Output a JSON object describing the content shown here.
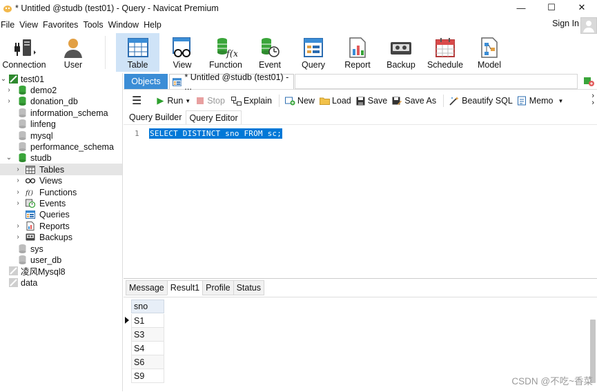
{
  "window": {
    "title": "* Untitled @studb (test01) - Query - Navicat Premium",
    "minimize": "—",
    "maximize": "☐",
    "close": "✕"
  },
  "menu": [
    "File",
    "View",
    "Favorites",
    "Tools",
    "Window",
    "Help"
  ],
  "account": {
    "sign_in": "Sign In"
  },
  "toolbar": [
    {
      "label": "Connection",
      "icon": "connection-icon"
    },
    {
      "label": "User",
      "icon": "user-icon"
    },
    {
      "label": "Table",
      "icon": "table-icon",
      "active": true
    },
    {
      "label": "View",
      "icon": "view-icon"
    },
    {
      "label": "Function",
      "icon": "function-icon"
    },
    {
      "label": "Event",
      "icon": "event-icon"
    },
    {
      "label": "Query",
      "icon": "query-icon"
    },
    {
      "label": "Report",
      "icon": "report-icon"
    },
    {
      "label": "Backup",
      "icon": "backup-icon"
    },
    {
      "label": "Schedule",
      "icon": "schedule-icon"
    },
    {
      "label": "Model",
      "icon": "model-icon"
    }
  ],
  "tree": [
    {
      "label": "test01",
      "type": "connection",
      "expanded": true
    },
    {
      "label": "demo2",
      "type": "db-active"
    },
    {
      "label": "donation_db",
      "type": "db-active"
    },
    {
      "label": "information_schema",
      "type": "db"
    },
    {
      "label": "linfeng",
      "type": "db"
    },
    {
      "label": "mysql",
      "type": "db"
    },
    {
      "label": "performance_schema",
      "type": "db"
    },
    {
      "label": "studb",
      "type": "db-active",
      "expanded": true
    },
    {
      "label": "Tables",
      "type": "tables",
      "selected": true
    },
    {
      "label": "Views",
      "type": "views"
    },
    {
      "label": "Functions",
      "type": "functions"
    },
    {
      "label": "Events",
      "type": "events"
    },
    {
      "label": "Queries",
      "type": "queries"
    },
    {
      "label": "Reports",
      "type": "reports"
    },
    {
      "label": "Backups",
      "type": "backups"
    },
    {
      "label": "sys",
      "type": "db"
    },
    {
      "label": "user_db",
      "type": "db"
    },
    {
      "label": "凌风Mysql8",
      "type": "connection-off"
    },
    {
      "label": "data",
      "type": "connection-off"
    }
  ],
  "tabs": {
    "objects": "Objects",
    "query_tab": "* Untitled @studb (test01) - ..."
  },
  "query_toolbar": {
    "run": "Run",
    "stop": "Stop",
    "explain": "Explain",
    "new": "New",
    "load": "Load",
    "save": "Save",
    "save_as": "Save As",
    "beautify": "Beautify SQL",
    "memo": "Memo"
  },
  "subtabs": [
    "Query Builder",
    "Query Editor"
  ],
  "editor": {
    "line_number": "1",
    "code": "SELECT DISTINCT sno FROM sc;"
  },
  "result_tabs": [
    "Message",
    "Result1",
    "Profile",
    "Status"
  ],
  "result": {
    "column": "sno",
    "rows": [
      "S1",
      "S3",
      "S4",
      "S6",
      "S9"
    ]
  },
  "watermark": "CSDN @不吃~香菜",
  "colors": {
    "accent": "#3b8dd6",
    "selection": "#0078d7",
    "db_green": "#3aa53a"
  }
}
